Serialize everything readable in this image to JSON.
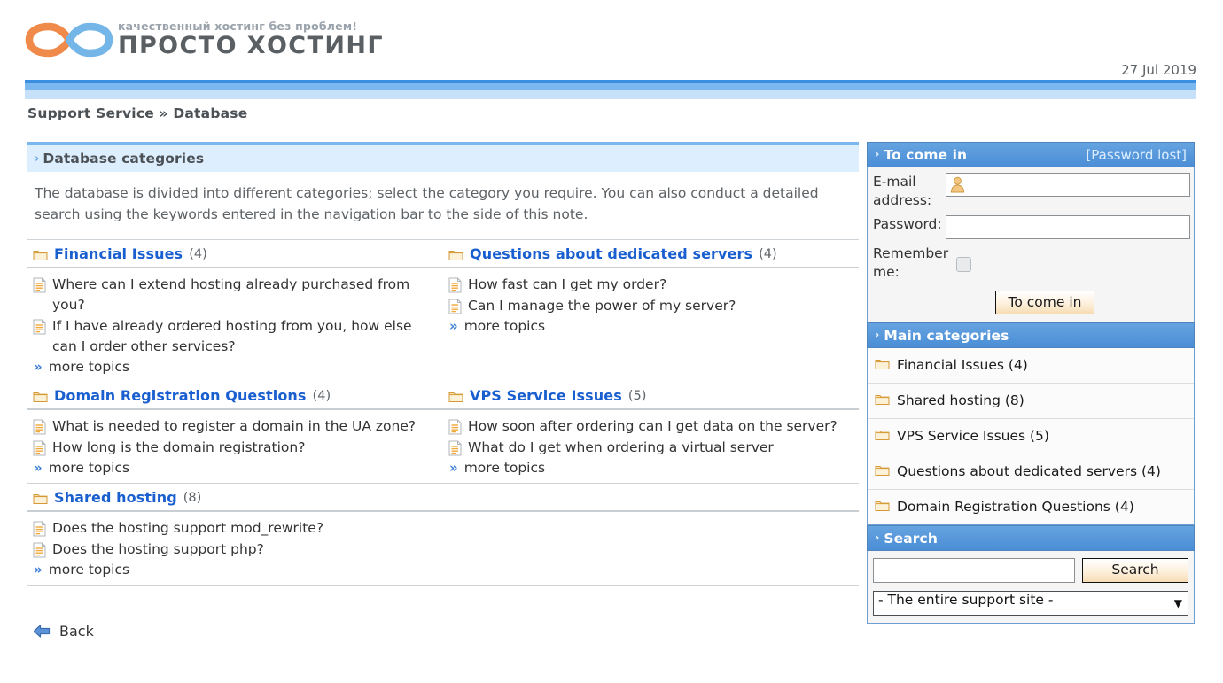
{
  "header": {
    "logo_tagline": "качественный хостинг без проблем!",
    "logo_name": "ПРОСТО ХОСТИНГ",
    "logo_icon": "infinity-logo",
    "date": "27 Jul 2019"
  },
  "breadcrumb": "Support Service » Database",
  "main": {
    "panel_title": "Database categories",
    "panel_arrow": "›",
    "intro": "The database is divided into different categories; select the category you require. You can also conduct a detailed search using the keywords entered in the navigation bar to the side of this note.",
    "more_label": "more topics",
    "more_chevron": "»",
    "back_label": "Back",
    "categories": [
      {
        "name": "Financial Issues",
        "count": "(4)",
        "topics": [
          "Where can I extend hosting already purchased from you?",
          "If I have already ordered hosting from you, how else can I order other services?"
        ]
      },
      {
        "name": "Questions about dedicated servers",
        "count": "(4)",
        "topics": [
          "How fast can I get my order?",
          "Can I manage the power of my server?"
        ]
      },
      {
        "name": "Domain Registration Questions",
        "count": "(4)",
        "topics": [
          "What is needed to register a domain in the UA zone?",
          "How long is the domain registration?"
        ]
      },
      {
        "name": "VPS Service Issues",
        "count": "(5)",
        "topics": [
          "How soon after ordering can I get data on the server?",
          "What do I get when ordering a virtual server"
        ]
      },
      {
        "name": "Shared hosting",
        "count": "(8)",
        "topics": [
          "Does the hosting support mod_rewrite?",
          "Does the hosting support php?"
        ]
      }
    ]
  },
  "sidebar": {
    "login": {
      "title": "To come in",
      "arrow": "›",
      "password_lost": "[Password lost]",
      "email_label": "E-mail address:",
      "email_value": "",
      "email_icon": "user-avatar-icon",
      "password_label": "Password:",
      "password_value": "",
      "remember_label": "Remember me:",
      "remember_checked": false,
      "submit_label": "To come in"
    },
    "main_categories": {
      "title": "Main categories",
      "arrow": "›",
      "items": [
        "Financial Issues (4)",
        "Shared hosting (8)",
        "VPS Service Issues (5)",
        "Questions about dedicated servers (4)",
        "Domain Registration Questions (4)"
      ]
    },
    "search": {
      "title": "Search",
      "arrow": "›",
      "query_value": "",
      "button_label": "Search",
      "scope_selected": "- The entire support site -",
      "scope_arrow": "▼"
    }
  },
  "colors": {
    "accent_blue": "#3b8fe0",
    "link_blue": "#1a5fd0",
    "header_light": "#ddeeff",
    "logo_orange": "#f08a4b",
    "logo_blue": "#74b6e8"
  }
}
